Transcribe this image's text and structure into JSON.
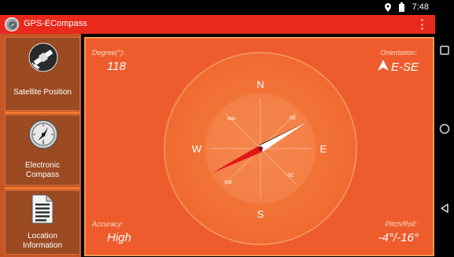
{
  "status_bar": {
    "time": "7:48",
    "icons": [
      "location-pin-icon",
      "battery-icon"
    ]
  },
  "app_bar": {
    "title": "GPS-ECompass",
    "icon": "app-logo-icon",
    "menu_icon": "overflow-menu-icon"
  },
  "sidebar": {
    "items": [
      {
        "label": "Satellite Position",
        "icon": "satellite-icon"
      },
      {
        "label": "Electronic\nCompass",
        "icon": "compass-gauge-icon"
      },
      {
        "label": "Location\nInformation",
        "icon": "document-icon"
      }
    ]
  },
  "compass": {
    "degree_label": "Degree(°):",
    "degree_value": "118",
    "orientation_label": "Orientation:",
    "orientation_value": "E-SE",
    "accuracy_label": "Accuracy:",
    "accuracy_value": "High",
    "pitch_roll_label": "Pitch/Roll:",
    "pitch_roll_value": "-4°/-16°",
    "cardinals": {
      "n": "N",
      "e": "E",
      "s": "S",
      "w": "W"
    },
    "intercardinals": {
      "nw": "NW",
      "ne": "NE",
      "sw": "SW",
      "se": "SE"
    },
    "heading_degrees": 118
  },
  "nav_bar": {
    "icons": [
      "recent-apps-icon",
      "home-icon",
      "back-icon"
    ]
  },
  "colors": {
    "app_bar": "#e8291c",
    "panel": "#ee5c2d",
    "sidebar": "#c75626",
    "needle_red": "#e21818",
    "needle_white": "#ffffff"
  }
}
